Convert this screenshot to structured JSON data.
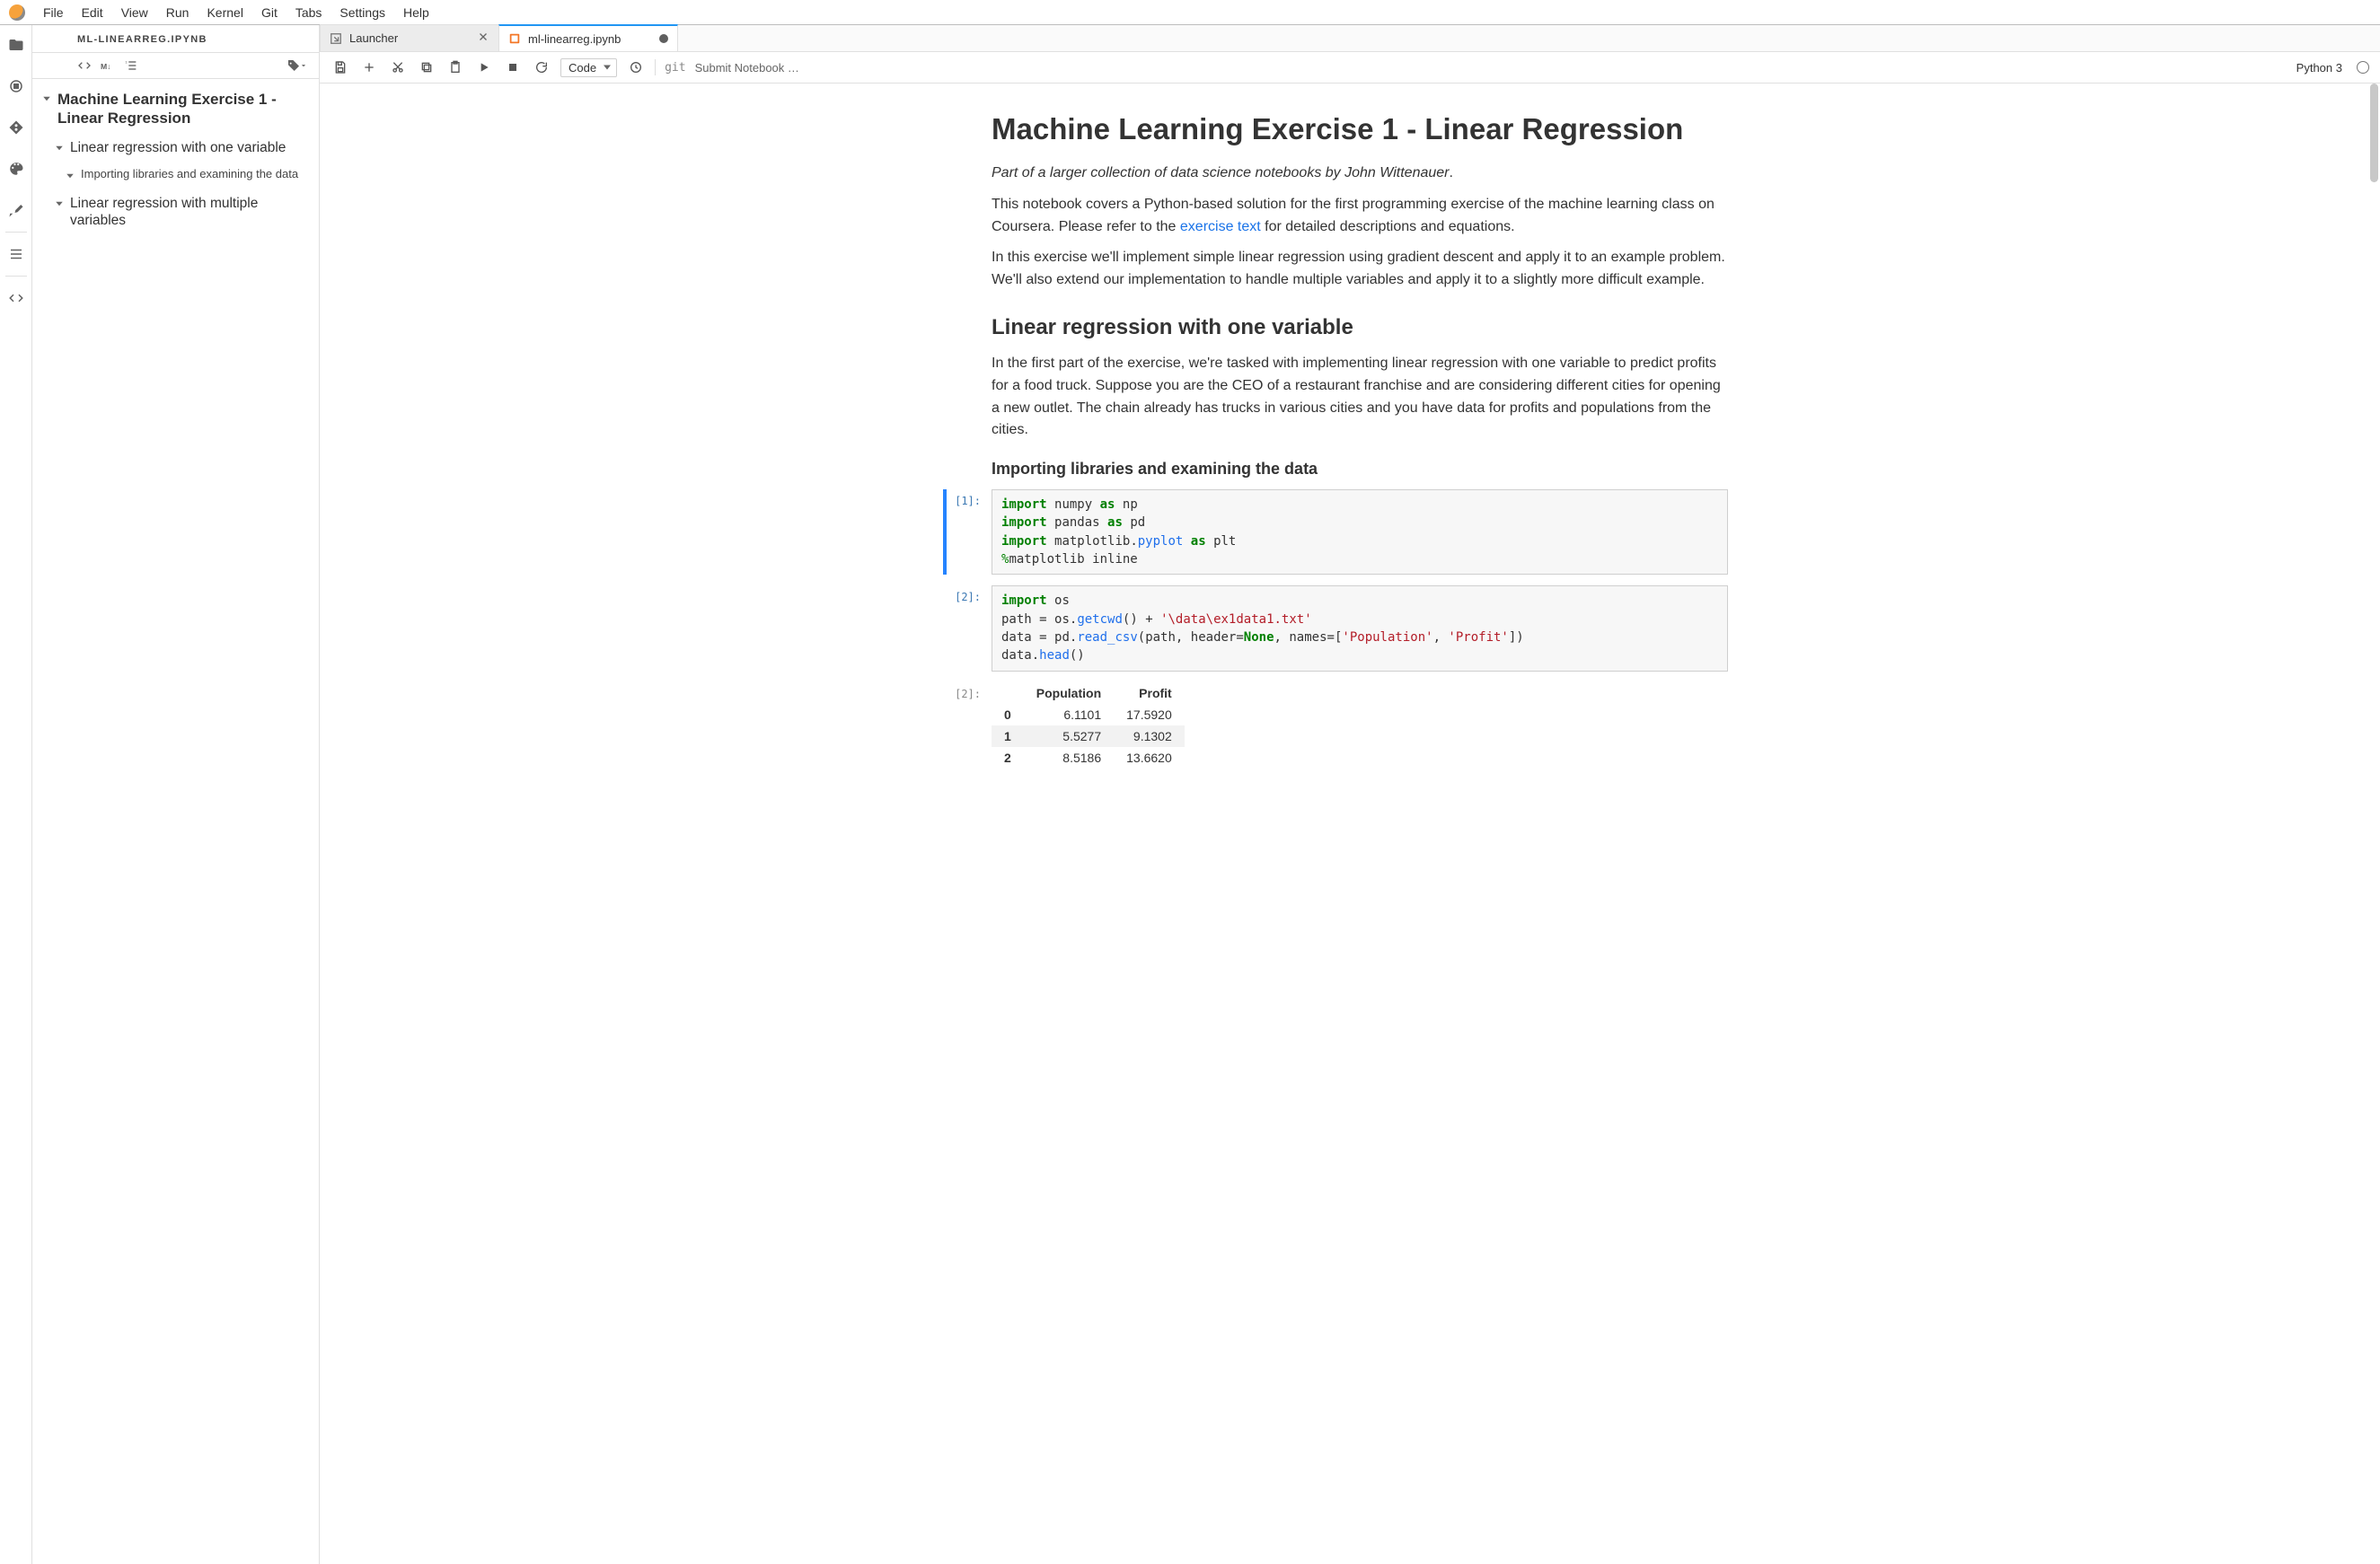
{
  "menu": {
    "items": [
      "File",
      "Edit",
      "View",
      "Run",
      "Kernel",
      "Git",
      "Tabs",
      "Settings",
      "Help"
    ]
  },
  "rail": {
    "group1": [
      "folder",
      "running",
      "extensions",
      "palette",
      "wrench"
    ],
    "group2": [
      "toc"
    ],
    "group3": [
      "code-snippets"
    ]
  },
  "outline": {
    "title": "ML-LINEARREG.IPYNB",
    "items": [
      {
        "level": 0,
        "expanded": true,
        "label": "Machine Learning Exercise 1 - Linear Regression"
      },
      {
        "level": 1,
        "expanded": true,
        "label": "Linear regression with one variable"
      },
      {
        "level": 2,
        "expanded": false,
        "label": "Importing libraries and examining the data"
      },
      {
        "level": 1,
        "expanded": true,
        "label": "Linear regression with multiple variables"
      }
    ]
  },
  "tabs": [
    {
      "icon": "launcher",
      "label": "Launcher",
      "state": "closeable",
      "active": false
    },
    {
      "icon": "notebook",
      "label": "ml-linearreg.ipynb",
      "state": "dirty",
      "active": true
    }
  ],
  "nb_toolbar": {
    "cell_type": "Code",
    "git_label": "git",
    "submit": "Submit Notebook …",
    "kernel": "Python 3"
  },
  "notebook": {
    "h1": "Machine Learning Exercise 1 - Linear Regression",
    "subtitle_before": "Part of a larger collection of data science notebooks by John Wittenauer",
    "subtitle_after": ".",
    "p1a": "This notebook covers a Python-based solution for the first programming exercise of the machine learning class on Coursera. Please refer to the ",
    "p1_link": "exercise text",
    "p1b": " for detailed descriptions and equations.",
    "p2": "In this exercise we'll implement simple linear regression using gradient descent and apply it to an example problem. We'll also extend our implementation to handle multiple variables and apply it to a slightly more difficult example.",
    "h2": "Linear regression with one variable",
    "p3": "In the first part of the exercise, we're tasked with implementing linear regression with one variable to predict profits for a food truck. Suppose you are the CEO of a restaurant franchise and are considering different cities for opening a new outlet. The chain already has trucks in various cities and you have data for profits and populations from the cities.",
    "h3": "Importing libraries and examining the data",
    "cell1_prompt": "[1]:",
    "cell2_prompt": "[2]:",
    "cell2_out_prompt": "[2]:",
    "code1": {
      "l1": {
        "kw": "import",
        "sp": " ",
        "id": "numpy",
        "sp2": " ",
        "as": "as",
        "sp3": " ",
        "al": "np"
      },
      "l2": {
        "kw": "import",
        "sp": " ",
        "id": "pandas",
        "sp2": " ",
        "as": "as",
        "sp3": " ",
        "al": "pd"
      },
      "l3": {
        "kw": "import",
        "sp": " ",
        "id": "matplotlib",
        "dot": ".",
        "sub": "pyplot",
        "sp2": " ",
        "as": "as",
        "sp3": " ",
        "al": "plt"
      },
      "l4": {
        "pct": "%",
        "mag": "matplotlib inline"
      }
    },
    "code2": {
      "l1": {
        "kw": "import",
        "sp": " ",
        "id": "os"
      },
      "l2": {
        "a": "path ",
        "eq": "=",
        "b": " os",
        "dot": ".",
        "fn": "getcwd",
        "par": "()",
        "plus": " + ",
        "str": "'\\data\\ex1data1.txt'"
      },
      "l3": {
        "a": "data ",
        "eq": "=",
        "b": " pd",
        "dot": ".",
        "fn": "read_csv",
        "open": "(",
        "arg1": "path",
        "com": ", ",
        "k1": "header",
        "eq2": "=",
        "none": "None",
        "com2": ", ",
        "k2": "names",
        "eq3": "=",
        "lb": "[",
        "s1": "'Population'",
        "com3": ", ",
        "s2": "'Profit'",
        "rb": "]",
        ")": ")"
      },
      "l4": {
        "a": "data",
        "dot": ".",
        "fn": "head",
        "par": "()"
      }
    },
    "table": {
      "cols": [
        "Population",
        "Profit"
      ],
      "rows": [
        {
          "i": "0",
          "c": [
            "6.1101",
            "17.5920"
          ]
        },
        {
          "i": "1",
          "c": [
            "5.5277",
            "9.1302"
          ]
        },
        {
          "i": "2",
          "c": [
            "8.5186",
            "13.6620"
          ]
        }
      ]
    }
  }
}
